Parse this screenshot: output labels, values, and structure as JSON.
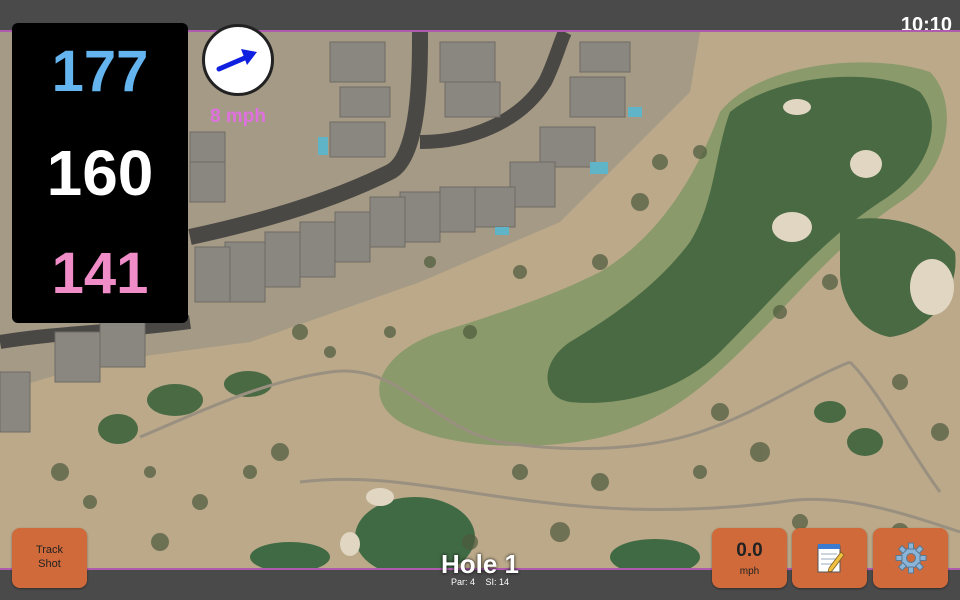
{
  "status": {
    "time": "10:10"
  },
  "distances": {
    "back": "177",
    "middle": "160",
    "front": "141"
  },
  "wind": {
    "speed_text": "8 mph",
    "direction_icon": "wind-arrow-icon"
  },
  "hole": {
    "title": "Hole 1",
    "par": "Par: 4",
    "si": "SI: 14"
  },
  "buttons": {
    "track_shot_line1": "Track",
    "track_shot_line2": "Shot",
    "speed_value": "0.0",
    "speed_unit": "mph",
    "notes_icon": "notepad-icon",
    "settings_icon": "gear-icon"
  },
  "colors": {
    "back_distance": "#64b4f0",
    "middle_distance": "#ffffff",
    "front_distance": "#f08cc8",
    "button": "#d06a3a",
    "map_border": "#b05ab0"
  }
}
